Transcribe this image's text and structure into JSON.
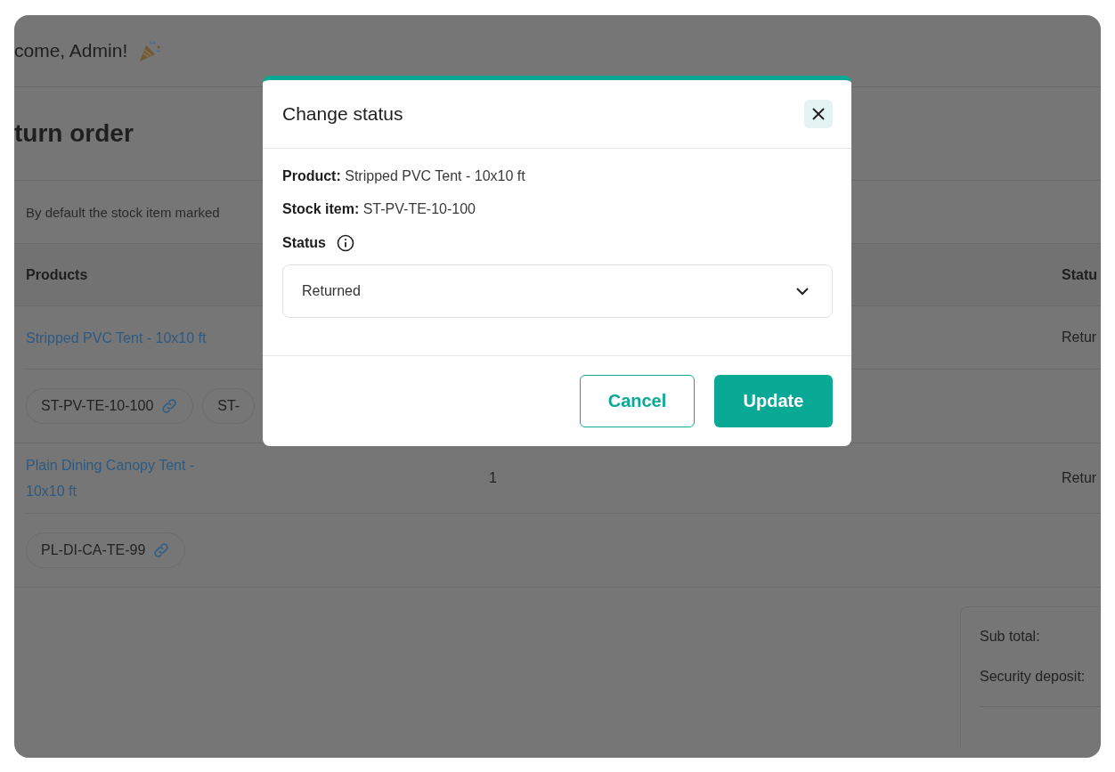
{
  "header": {
    "greeting": "come, Admin!"
  },
  "page": {
    "title": "turn order",
    "note": "By default the stock item marked"
  },
  "table": {
    "columns": [
      "Products",
      "Statu"
    ],
    "rows": [
      {
        "product": "Stripped PVC Tent - 10x10 ft",
        "status": "Retur",
        "stock_items": [
          {
            "code": "ST-PV-TE-10-100",
            "link": true
          },
          {
            "code": "ST-",
            "link": false
          }
        ]
      },
      {
        "product": "Plain Dining Canopy Tent - 10x10 ft",
        "quantity": "1",
        "status": "Retur",
        "stock_items": [
          {
            "code": "PL-DI-CA-TE-99",
            "link": true
          }
        ]
      }
    ]
  },
  "summary": {
    "labels": [
      "Sub total:",
      "Security deposit:"
    ]
  },
  "modal": {
    "title": "Change status",
    "product_label": "Product:",
    "product": "Stripped PVC Tent - 10x10 ft",
    "stock_label": "Stock item:",
    "stock": "ST-PV-TE-10-100",
    "status_label": "Status",
    "status_value": "Returned",
    "buttons": [
      {
        "label": "Cancel",
        "kind": "secondary"
      },
      {
        "label": "Update",
        "kind": "primary"
      }
    ]
  }
}
